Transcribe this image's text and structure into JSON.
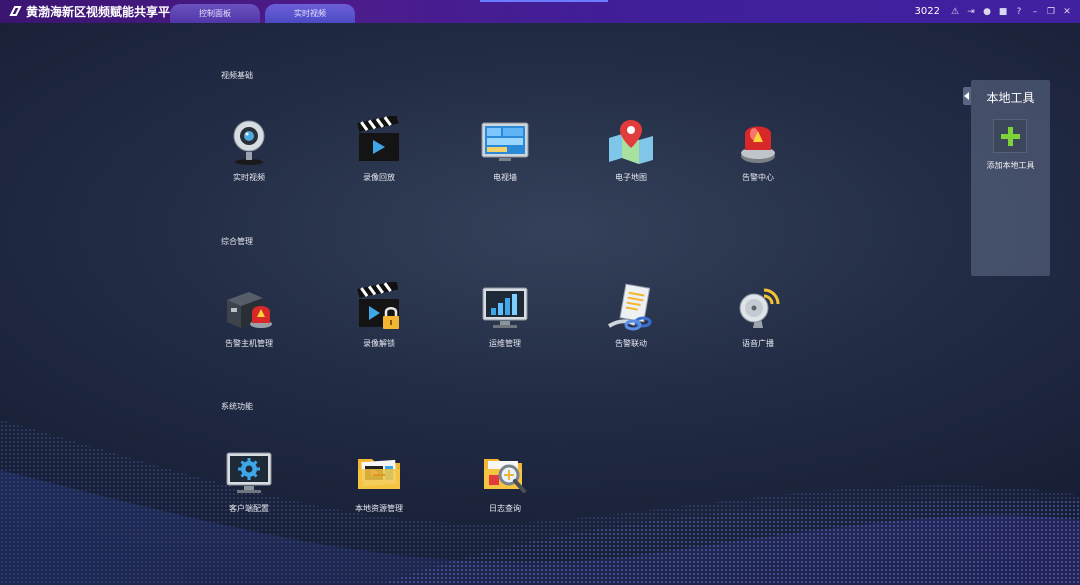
{
  "window": {
    "title": "黄渤海新区视频赋能共享平台",
    "user_number": "3022"
  },
  "tabs": [
    {
      "label": "控制面板"
    },
    {
      "label": "实时视频"
    }
  ],
  "sections": [
    {
      "label": "视频基础",
      "items": [
        {
          "label": "实时视频",
          "icon": "webcam-icon"
        },
        {
          "label": "录像回放",
          "icon": "clapperboard-icon"
        },
        {
          "label": "电视墙",
          "icon": "tv-wall-icon"
        },
        {
          "label": "电子地图",
          "icon": "map-pin-icon"
        },
        {
          "label": "告警中心",
          "icon": "alarm-light-icon"
        }
      ]
    },
    {
      "label": "综合管理",
      "items": [
        {
          "label": "告警主机管理",
          "icon": "alarm-host-icon"
        },
        {
          "label": "录像解锁",
          "icon": "clapperboard-lock-icon"
        },
        {
          "label": "运维管理",
          "icon": "monitor-chart-icon"
        },
        {
          "label": "告警联动",
          "icon": "document-link-icon"
        },
        {
          "label": "语音广播",
          "icon": "broadcast-dish-icon"
        }
      ]
    },
    {
      "label": "系统功能",
      "items": [
        {
          "label": "客户端配置",
          "icon": "monitor-gear-icon"
        },
        {
          "label": "本地资源管理",
          "icon": "folder-media-icon"
        },
        {
          "label": "日志查询",
          "icon": "folder-search-icon"
        }
      ]
    }
  ],
  "local_tools": {
    "title": "本地工具",
    "add_label": "添加本地工具"
  }
}
